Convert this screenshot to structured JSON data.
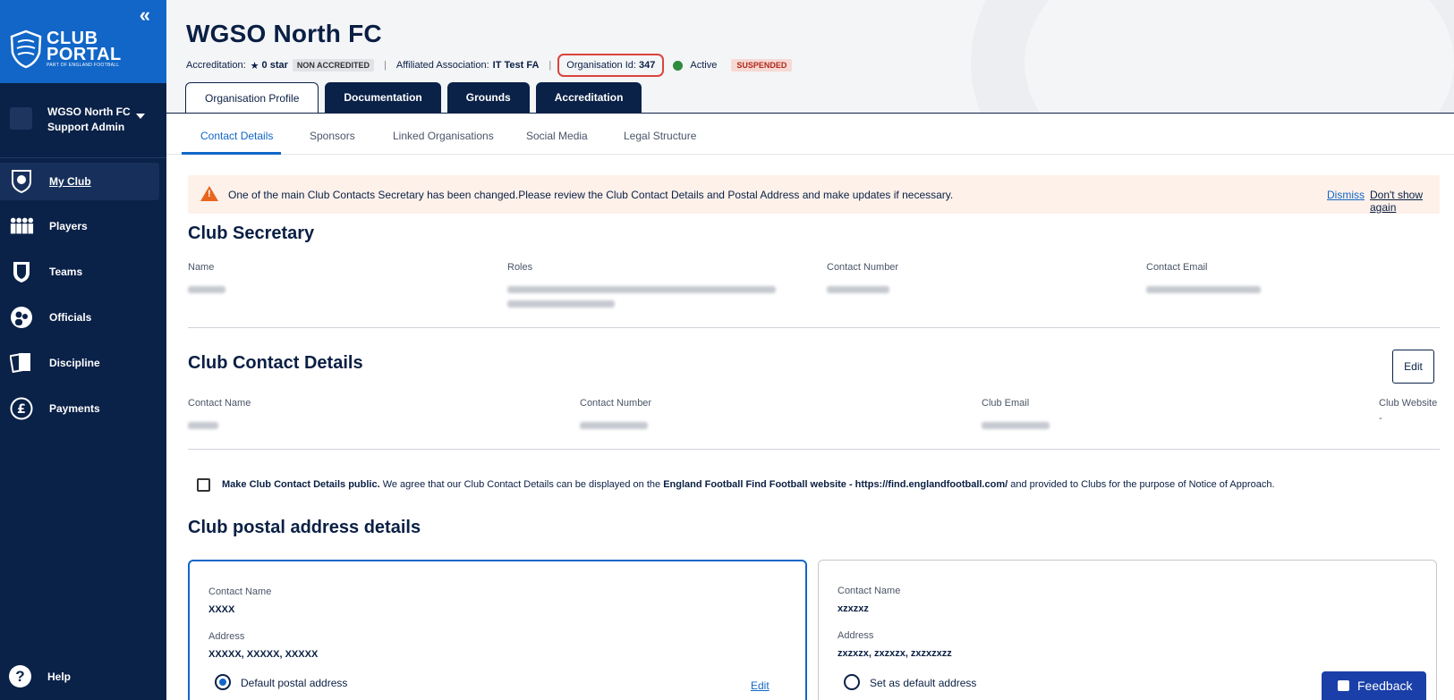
{
  "sidebar": {
    "collapse_icon": "«",
    "brand_line1": "CLUB",
    "brand_line2": "PORTAL",
    "brand_sub": "PART OF ENGLAND FOOTBALL",
    "user_name": "WGSO North FC",
    "user_role": "Support Admin",
    "nav": [
      {
        "label": "My Club",
        "icon": "shield-ball-icon",
        "active": true
      },
      {
        "label": "Players",
        "icon": "players-icon"
      },
      {
        "label": "Teams",
        "icon": "team-shield-icon"
      },
      {
        "label": "Officials",
        "icon": "officials-icon"
      },
      {
        "label": "Discipline",
        "icon": "cards-icon"
      },
      {
        "label": "Payments",
        "icon": "pound-icon"
      }
    ],
    "help_label": "Help"
  },
  "header": {
    "title": "WGSO North FC",
    "accreditation_label": "Accreditation:",
    "accreditation_value": "0 star",
    "accreditation_badge": "NON ACCREDITED",
    "association_label": "Affiliated Association:",
    "association_value": "IT Test FA",
    "org_id_label": "Organisation Id:",
    "org_id_value": "347",
    "status_label": "Active",
    "status_badge": "SUSPENDED",
    "tabs": [
      "Organisation Profile",
      "Documentation",
      "Grounds",
      "Accreditation"
    ]
  },
  "subtabs": [
    "Contact Details",
    "Sponsors",
    "Linked Organisations",
    "Social Media",
    "Legal Structure"
  ],
  "alert": {
    "message": "One of the main Club Contacts Secretary has been changed.Please review the Club Contact Details and Postal Address and make updates if necessary.",
    "dismiss": "Dismiss",
    "dont_show": "Don't show again"
  },
  "secretary": {
    "heading": "Club Secretary",
    "labels": {
      "name": "Name",
      "roles": "Roles",
      "number": "Contact Number",
      "email": "Contact Email"
    }
  },
  "contact": {
    "heading": "Club Contact Details",
    "edit_label": "Edit",
    "labels": {
      "name": "Contact Name",
      "number": "Contact Number",
      "email": "Club Email",
      "website": "Club Website"
    },
    "website_value": "-"
  },
  "consent": {
    "bold_lead": "Make Club Contact Details public.",
    "text1": " We agree that our Club Contact Details can be displayed on the ",
    "bold_site": "England Football Find Football website - https://find.englandfootball.com/",
    "text2": " and provided to Clubs for the purpose of Notice of Approach."
  },
  "postal": {
    "heading": "Club postal address details",
    "cards": [
      {
        "contact_label": "Contact Name",
        "contact_value": "XXXX",
        "address_label": "Address",
        "address_value": "XXXXX, XXXXX, XXXXX",
        "radio_label": "Default postal address",
        "edit_label": "Edit"
      },
      {
        "contact_label": "Contact Name",
        "contact_value": "xzxzxz",
        "address_label": "Address",
        "address_value": "zxzxzx, zxzxzx, zxzxzxzz",
        "radio_label": "Set as default address"
      }
    ]
  },
  "feedback_label": "Feedback",
  "colors": {
    "navy": "#0a2148",
    "brand_blue": "#1166c7",
    "active_green": "#2e8a3c",
    "suspended_red": "#b0281a",
    "alert_bg": "#fdf1ea"
  }
}
